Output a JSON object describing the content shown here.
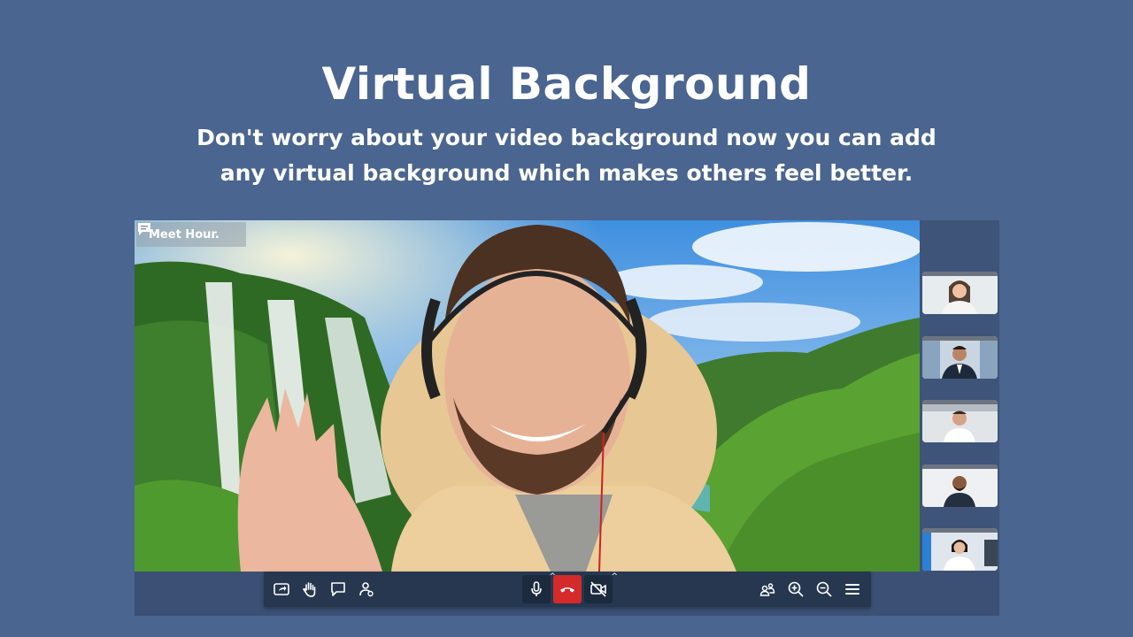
{
  "hero": {
    "title": "Virtual Background",
    "subtitle_line1": "Don't worry about your video background now you can add",
    "subtitle_line2": "any virtual background which makes others feel better."
  },
  "watermark": {
    "label": "Meet Hour.",
    "icon": "chat-bubble-icon"
  },
  "participants": [
    "woman-participant",
    "man-suit-participant",
    "man-smiling-participant",
    "man-beard-participant",
    "woman-office-participant"
  ],
  "toolbar": {
    "left": [
      "share-screen-icon",
      "raise-hand-icon",
      "chat-icon",
      "participants-icon"
    ],
    "center": [
      "microphone-icon",
      "hangup-icon",
      "camera-off-icon"
    ],
    "right": [
      "tile-view-icon",
      "zoom-in-icon",
      "zoom-out-icon",
      "menu-icon"
    ]
  },
  "colors": {
    "background": "#4a6590",
    "toolbar": "#26374f",
    "hangup": "#d42a2a"
  }
}
